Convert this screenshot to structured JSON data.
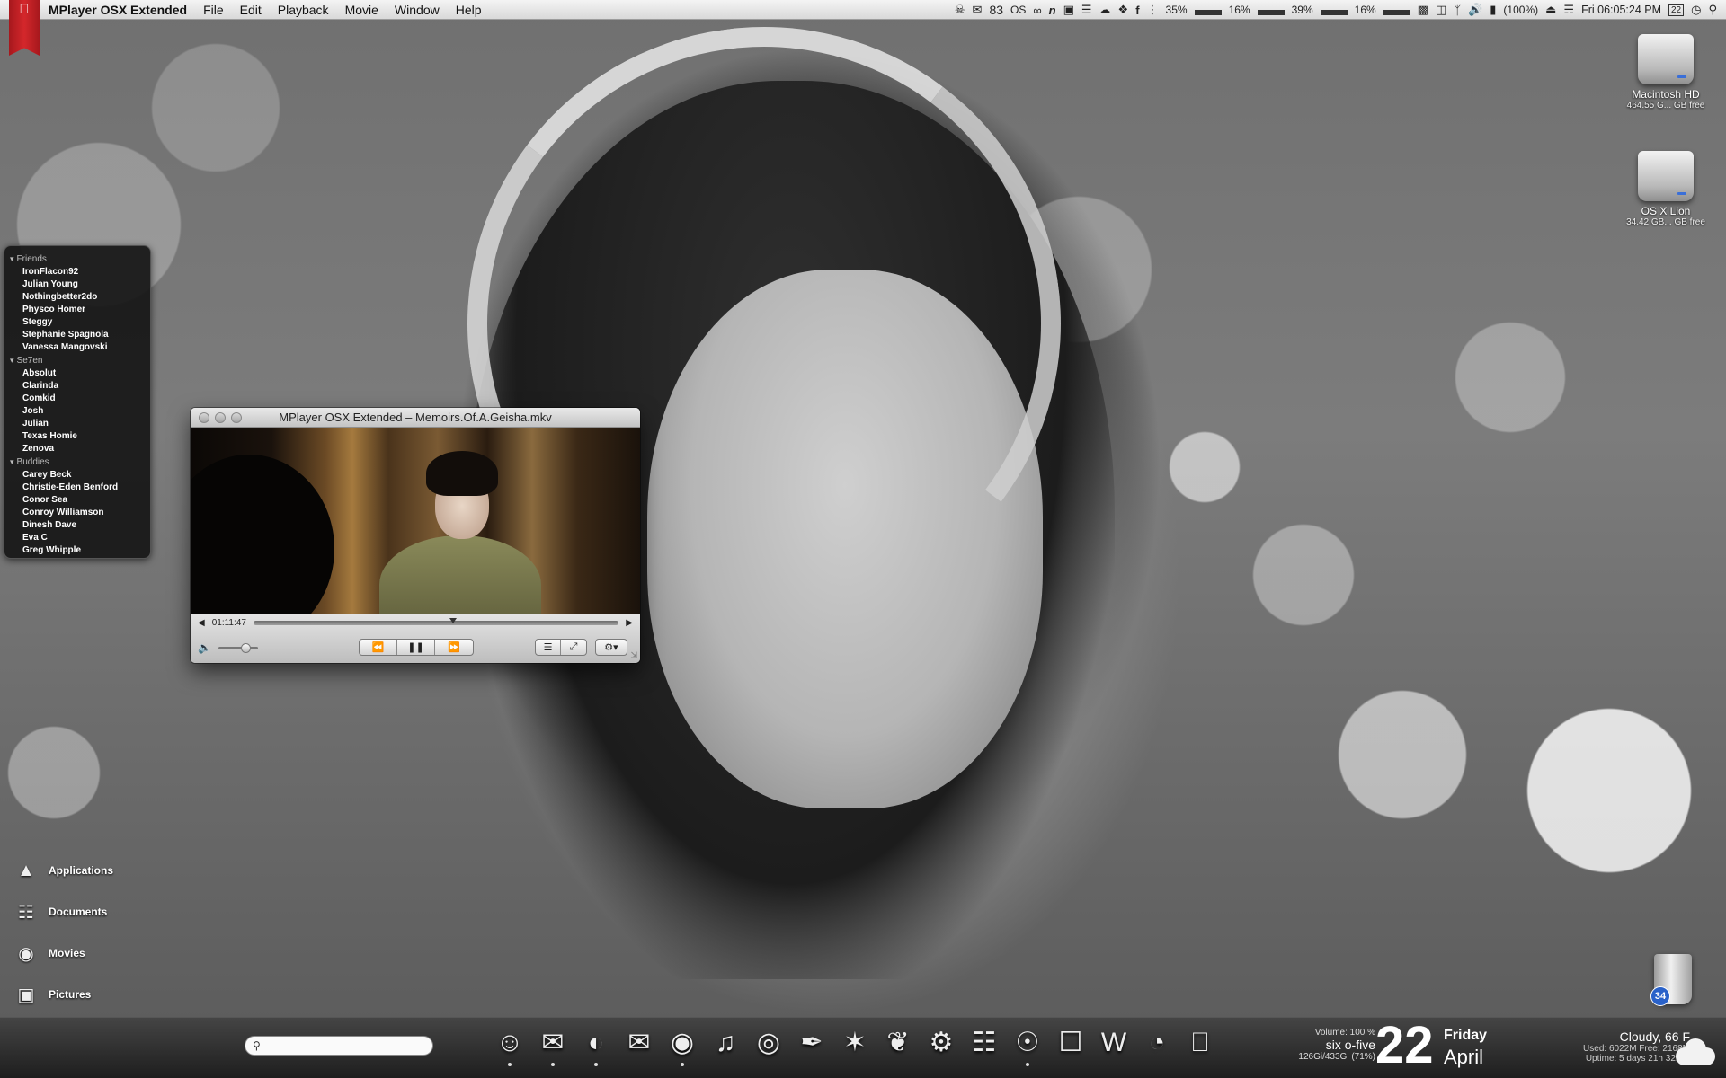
{
  "menubar": {
    "app_name": "MPlayer OSX Extended",
    "menus": [
      "File",
      "Edit",
      "Playback",
      "Movie",
      "Window",
      "Help"
    ],
    "tray": {
      "badge_count": "83",
      "os_label": "OS",
      "cpu_percents": [
        "35%",
        "16%",
        "39%",
        "16%"
      ],
      "battery": "(100%)",
      "clock": "Fri 06:05:24 PM",
      "calendar_day": "22"
    }
  },
  "desktop": {
    "drives": [
      {
        "name": "Macintosh HD",
        "free": "464.55 G... GB free"
      },
      {
        "name": "OS X Lion",
        "free": "34.42 GB... GB free"
      }
    ],
    "places": [
      "Applications",
      "Documents",
      "Movies",
      "Pictures"
    ],
    "trash_badge": "34"
  },
  "buddies": {
    "groups": [
      {
        "name": "Friends",
        "members": [
          "IronFlacon92",
          "Julian Young",
          "Nothingbetter2do",
          "Physco Homer",
          "Steggy",
          "Stephanie Spagnola",
          "Vanessa Mangovski"
        ]
      },
      {
        "name": "Se7en",
        "members": [
          "Absolut",
          "Clarinda",
          "Comkid",
          "Josh",
          "Julian",
          "Texas Homie",
          "Zenova"
        ]
      },
      {
        "name": "Buddies",
        "members": [
          "Carey Beck",
          "Christie-Eden Benford",
          "Conor Sea",
          "Conroy Williamson",
          "Dinesh Dave",
          "Eva C",
          "Greg Whipple"
        ]
      }
    ]
  },
  "player": {
    "title": "MPlayer OSX Extended – Memoirs.Of.A.Geisha.mkv",
    "time": "01:11:47",
    "progress": 0.5,
    "volume": 0.7
  },
  "bottombar": {
    "search_placeholder": "",
    "dock_icons": [
      "finder-icon",
      "messages-icon",
      "firefox-icon",
      "mail-icon",
      "eye-icon",
      "music-icon",
      "quicktime-icon",
      "feather-icon",
      "puzzle-icon",
      "butterfly-icon",
      "settings-icon",
      "scroll-icon",
      "compass-icon",
      "document-icon",
      "word-icon",
      "aperture-icon",
      "trash-icon"
    ],
    "stats": {
      "volume": "Volume: 100 %",
      "time_words": "six o-five",
      "disk": "126Gi/433Gi (71%)"
    },
    "date": {
      "day": "22",
      "weekday": "Friday",
      "month": "April"
    },
    "weather": {
      "condition": "Cloudy, 66 F",
      "memory": "Used: 6022M Free: 2168M",
      "uptime": "Uptime: 5 days 21h 32min"
    }
  }
}
